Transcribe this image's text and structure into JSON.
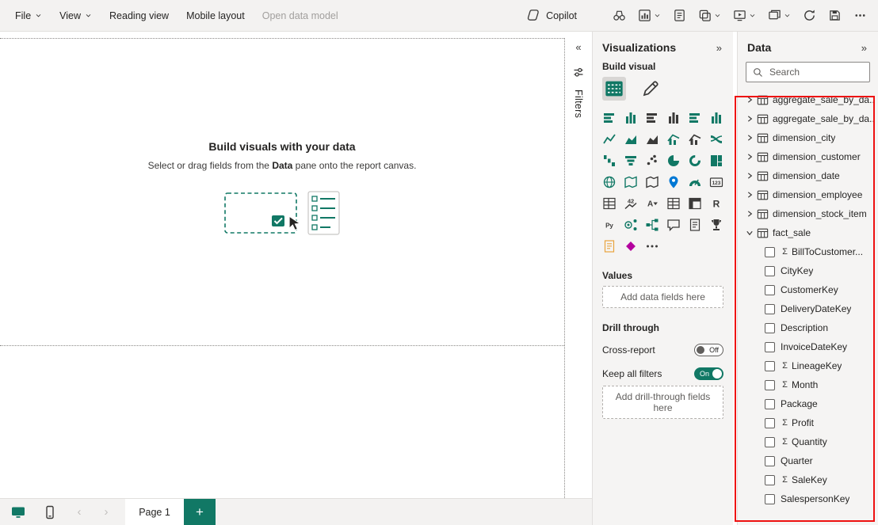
{
  "colors": {
    "accent": "#117865",
    "dark_icon": "#3b3a39",
    "annotation": "#ee1111"
  },
  "toolbar": {
    "menus": [
      {
        "label": "File",
        "chevron": true,
        "disabled": false
      },
      {
        "label": "View",
        "chevron": true,
        "disabled": false
      },
      {
        "label": "Reading view",
        "chevron": false,
        "disabled": false
      },
      {
        "label": "Mobile layout",
        "chevron": false,
        "disabled": false
      },
      {
        "label": "Open data model",
        "chevron": false,
        "disabled": true
      }
    ],
    "copilot_label": "Copilot",
    "right_icons": [
      {
        "name": "binoculars-icon",
        "chevron": false
      },
      {
        "name": "new-visual-icon",
        "chevron": true
      },
      {
        "name": "notes-icon",
        "chevron": false
      },
      {
        "name": "buttons-icon",
        "chevron": true
      },
      {
        "name": "presenter-mode-icon",
        "chevron": true
      },
      {
        "name": "window-icon",
        "chevron": true
      },
      {
        "name": "refresh-icon",
        "chevron": false
      },
      {
        "name": "save-icon",
        "chevron": false
      },
      {
        "name": "more-options-icon",
        "chevron": false
      }
    ]
  },
  "canvas": {
    "empty_state": {
      "title": "Build visuals with your data",
      "subtitle_prefix": "Select or drag fields from the ",
      "subtitle_bold": "Data",
      "subtitle_suffix": " pane onto the report canvas."
    }
  },
  "filters_pane": {
    "collapse_glyph": "«",
    "label": "Filters"
  },
  "visualizations_pane": {
    "title": "Visualizations",
    "collapse_glyph": "»",
    "build_visual_label": "Build visual",
    "values_label": "Values",
    "values_placeholder": "Add data fields here",
    "drill_through_label": "Drill through",
    "cross_report_label": "Cross-report",
    "cross_report_state": "Off",
    "keep_all_filters_label": "Keep all filters",
    "keep_all_filters_state": "On",
    "drill_placeholder": "Add drill-through fields here",
    "visual_types": [
      {
        "name": "stacked-bar-chart",
        "glyph": "hbar",
        "color": "#117865"
      },
      {
        "name": "stacked-column-chart",
        "glyph": "vbar",
        "color": "#117865"
      },
      {
        "name": "clustered-bar-chart",
        "glyph": "hbar",
        "color": "#3b3a39"
      },
      {
        "name": "clustered-column-chart",
        "glyph": "vbar",
        "color": "#3b3a39"
      },
      {
        "name": "100-stacked-bar-chart",
        "glyph": "hbar",
        "color": "#117865"
      },
      {
        "name": "100-stacked-column-chart",
        "glyph": "vbar",
        "color": "#117865"
      },
      {
        "name": "line-chart",
        "glyph": "line",
        "color": "#117865"
      },
      {
        "name": "area-chart",
        "glyph": "area",
        "color": "#117865"
      },
      {
        "name": "stacked-area-chart",
        "glyph": "area",
        "color": "#3b3a39"
      },
      {
        "name": "line-and-stacked-column-chart",
        "glyph": "combo",
        "color": "#117865"
      },
      {
        "name": "line-and-clustered-column-chart",
        "glyph": "combo",
        "color": "#3b3a39"
      },
      {
        "name": "ribbon-chart",
        "glyph": "ribbon",
        "color": "#117865"
      },
      {
        "name": "waterfall-chart",
        "glyph": "waterfall",
        "color": "#117865"
      },
      {
        "name": "funnel-chart",
        "glyph": "funnel",
        "color": "#117865"
      },
      {
        "name": "scatter-chart",
        "glyph": "scatter",
        "color": "#3b3a39"
      },
      {
        "name": "pie-chart",
        "glyph": "pie",
        "color": "#117865"
      },
      {
        "name": "donut-chart",
        "glyph": "donut",
        "color": "#117865"
      },
      {
        "name": "treemap",
        "glyph": "treemap",
        "color": "#117865"
      },
      {
        "name": "map",
        "glyph": "globe",
        "color": "#117865"
      },
      {
        "name": "filled-map",
        "glyph": "map",
        "color": "#117865"
      },
      {
        "name": "shape-map",
        "glyph": "map",
        "color": "#3b3a39"
      },
      {
        "name": "azure-map",
        "glyph": "pin",
        "color": "#0078d4"
      },
      {
        "name": "gauge",
        "glyph": "gauge",
        "color": "#117865"
      },
      {
        "name": "card",
        "glyph": "card",
        "color": "#3b3a39"
      },
      {
        "name": "multi-row-card",
        "glyph": "table",
        "color": "#3b3a39"
      },
      {
        "name": "kpi",
        "glyph": "kpi",
        "color": "#3b3a39"
      },
      {
        "name": "slicer",
        "glyph": "slicer",
        "color": "#3b3a39"
      },
      {
        "name": "table",
        "glyph": "table",
        "color": "#3b3a39"
      },
      {
        "name": "matrix",
        "glyph": "matrix",
        "color": "#3b3a39"
      },
      {
        "name": "r-script-visual",
        "glyph": "r",
        "color": "#3b3a39"
      },
      {
        "name": "python-visual",
        "glyph": "py",
        "color": "#3b3a39"
      },
      {
        "name": "key-influencers",
        "glyph": "influencer",
        "color": "#117865"
      },
      {
        "name": "decomposition-tree",
        "glyph": "tree",
        "color": "#117865"
      },
      {
        "name": "qa-visual",
        "glyph": "bubble",
        "color": "#3b3a39"
      },
      {
        "name": "smart-narrative",
        "glyph": "page",
        "color": "#3b3a39"
      },
      {
        "name": "metrics",
        "glyph": "trophy",
        "color": "#3b3a39"
      },
      {
        "name": "paginated-report",
        "glyph": "page",
        "color": "#e8a33d"
      },
      {
        "name": "power-apps",
        "glyph": "diamond",
        "color": "#b4009e"
      },
      {
        "name": "get-more-visuals",
        "glyph": "more",
        "color": "#3b3a39"
      }
    ]
  },
  "data_pane": {
    "title": "Data",
    "collapse_glyph": "»",
    "search_placeholder": "Search",
    "tables": [
      {
        "name": "aggregate_sale_by_da...",
        "expanded": false
      },
      {
        "name": "aggregate_sale_by_da...",
        "expanded": false
      },
      {
        "name": "dimension_city",
        "expanded": false
      },
      {
        "name": "dimension_customer",
        "expanded": false
      },
      {
        "name": "dimension_date",
        "expanded": false
      },
      {
        "name": "dimension_employee",
        "expanded": false
      },
      {
        "name": "dimension_stock_item",
        "expanded": false
      },
      {
        "name": "fact_sale",
        "expanded": true,
        "fields": [
          {
            "name": "BillToCustomer...",
            "sigma": true
          },
          {
            "name": "CityKey",
            "sigma": false
          },
          {
            "name": "CustomerKey",
            "sigma": false
          },
          {
            "name": "DeliveryDateKey",
            "sigma": false
          },
          {
            "name": "Description",
            "sigma": false
          },
          {
            "name": "InvoiceDateKey",
            "sigma": false
          },
          {
            "name": "LineageKey",
            "sigma": true
          },
          {
            "name": "Month",
            "sigma": true
          },
          {
            "name": "Package",
            "sigma": false
          },
          {
            "name": "Profit",
            "sigma": true
          },
          {
            "name": "Quantity",
            "sigma": true
          },
          {
            "name": "Quarter",
            "sigma": false
          },
          {
            "name": "SaleKey",
            "sigma": true
          },
          {
            "name": "SalespersonKey",
            "sigma": false
          }
        ]
      }
    ]
  },
  "bottom_bar": {
    "page_tab_label": "Page 1",
    "add_page_glyph": "+",
    "prev_glyph": "‹",
    "next_glyph": "›"
  }
}
